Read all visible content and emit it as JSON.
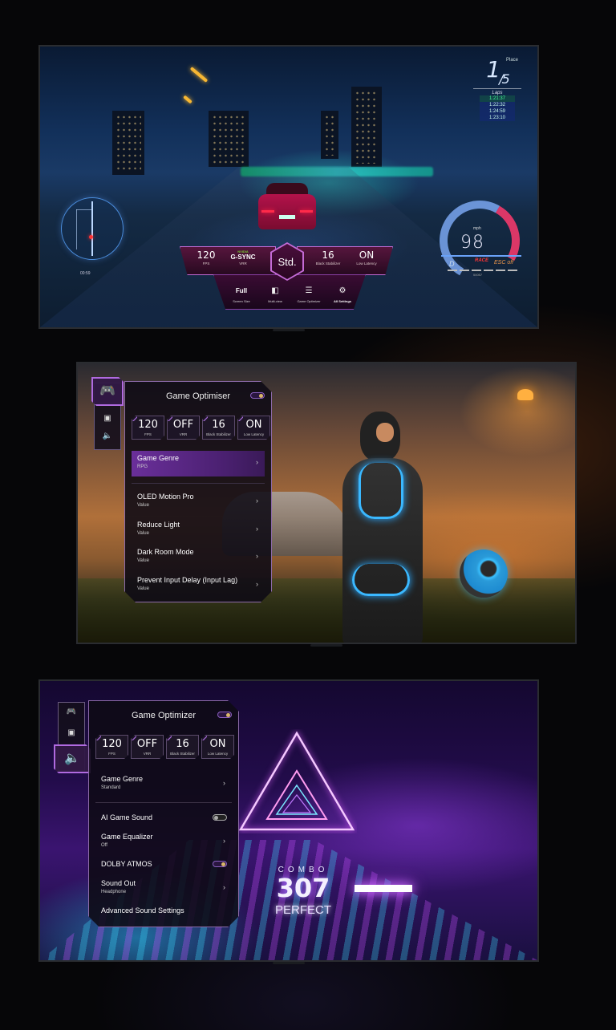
{
  "racing": {
    "place_label": "Place",
    "place_current": "1",
    "place_total": "5",
    "laps_label": "Laps",
    "laps": [
      "1:21:37",
      "1:22:32",
      "1:24:59",
      "1:23:10"
    ],
    "minimap_time": "00:59",
    "speed_unit": "mph",
    "speed_value": "98",
    "gear": "D",
    "drive_mode": "RACE",
    "esc": "ESC off",
    "odometer": "00057",
    "hud": {
      "fps_value": "120",
      "fps_label": "FPS",
      "vrr_brand_top": "NVIDIA",
      "vrr_brand": "G-SYNC",
      "vrr_label": "VRR",
      "mode": "Std.",
      "black_value": "16",
      "black_label": "Black Stabilizer",
      "latency_value": "ON",
      "latency_label": "Low Latency",
      "items": [
        {
          "value": "Full",
          "label": "Screen Size"
        },
        {
          "icon": "multiview-icon",
          "label": "Multi-view"
        },
        {
          "icon": "sliders-icon",
          "label": "Game Optimizer"
        },
        {
          "icon": "gear-icon",
          "label": "All Settings"
        }
      ],
      "help": "?"
    }
  },
  "panel2": {
    "title": "Game Optimiser",
    "toggle_on": true,
    "tabs": [
      "gamepad-icon",
      "picture-icon",
      "speaker-icon"
    ],
    "active_tab": 0,
    "stats": [
      {
        "value": "120",
        "label": "FPS"
      },
      {
        "value": "OFF",
        "label": "VRR"
      },
      {
        "value": "16",
        "label": "Black Stabilizer"
      },
      {
        "value": "ON",
        "label": "Low Latency"
      }
    ],
    "items": [
      {
        "title": "Game Genre",
        "sub": "RPG",
        "selected": true
      },
      {
        "title": "OLED Motion Pro",
        "sub": "Value"
      },
      {
        "title": "Reduce Light",
        "sub": "Value"
      },
      {
        "title": "Dark Room Mode",
        "sub": "Value"
      },
      {
        "title": "Prevent Input Delay (Input Lag)",
        "sub": "Value"
      }
    ]
  },
  "panel3": {
    "title": "Game Optimizer",
    "toggle_on": true,
    "tabs": [
      "gamepad-icon",
      "picture-icon",
      "speaker-icon"
    ],
    "active_tab": 2,
    "stats": [
      {
        "value": "120",
        "label": "FPS"
      },
      {
        "value": "OFF",
        "label": "VRR"
      },
      {
        "value": "16",
        "label": "Black Stabilizer"
      },
      {
        "value": "ON",
        "label": "Low Latency"
      }
    ],
    "genre": {
      "title": "Game Genre",
      "sub": "Standard"
    },
    "items": [
      {
        "title": "AI Game Sound",
        "type": "toggle",
        "on": false
      },
      {
        "title": "Game Equalizer",
        "sub": "Off",
        "type": "chevron"
      },
      {
        "title": "DOLBY ATMOS",
        "type": "toggle",
        "on": true
      },
      {
        "title": "Sound Out",
        "sub": "Headphone",
        "type": "chevron"
      },
      {
        "title": "Advanced Sound Settings",
        "type": "link"
      }
    ]
  },
  "rhythm": {
    "combo_label": "COMBO",
    "combo_value": "307",
    "grade": "PERFECT"
  },
  "glyphs": {
    "chevron": "›",
    "gamepad": "🎮",
    "speaker": "🔈",
    "picture": "▣",
    "multiview": "◧",
    "sliders": "☰",
    "gear": "⚙"
  }
}
